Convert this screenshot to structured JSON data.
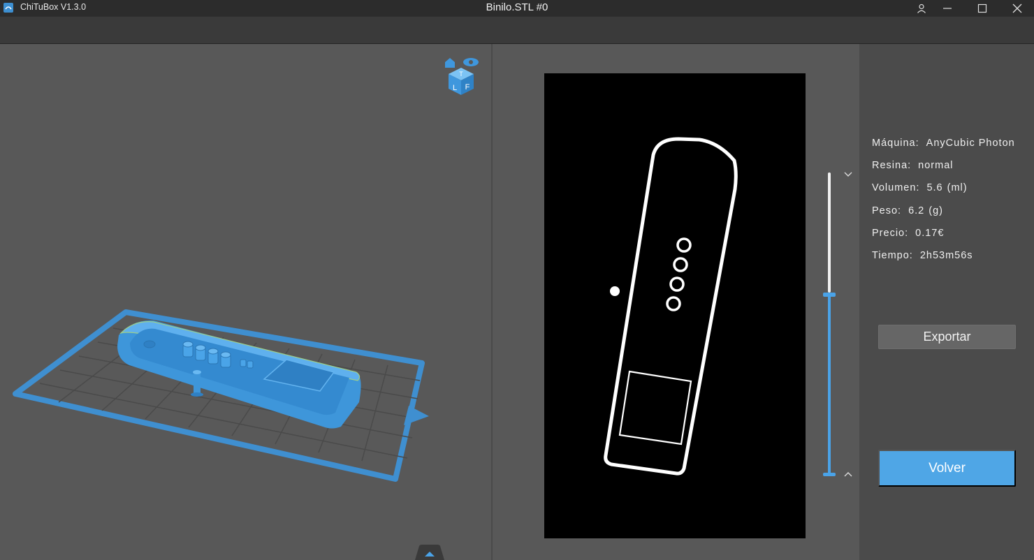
{
  "titlebar": {
    "app_name": "ChiTuBox V1.3.0",
    "document_title": "Binilo.STL #0",
    "icons": [
      "app-logo-icon",
      "user-icon",
      "minimize-icon",
      "maximize-icon",
      "close-icon"
    ]
  },
  "viewport": {
    "view_cube_icon": "view-cube-icon",
    "view_cube_faces": [
      "T",
      "L",
      "F"
    ],
    "collapse_icon": "chevron-up-icon"
  },
  "preview": {
    "layer_slider": {
      "position": 0.4,
      "up_icon": "chevron-down-icon",
      "down_icon": "chevron-up-icon"
    }
  },
  "info": {
    "machine_label": "Máquina:",
    "machine_value": "AnyCubic Photon",
    "resin_label": "Resina:",
    "resin_value": "normal",
    "volume_label": "Volumen:",
    "volume_value": "5.6",
    "volume_unit": "(ml)",
    "weight_label": "Peso:",
    "weight_value": "6.2",
    "weight_unit": "(g)",
    "price_label": "Precio:",
    "price_value": "0.17€",
    "time_label": "Tiempo:",
    "time_value": "2h53m56s"
  },
  "actions": {
    "export_label": "Exportar",
    "back_label": "Volver"
  },
  "colors": {
    "accent": "#4fa6e6",
    "model": "#3f97dd",
    "viewport_bg": "#585858",
    "panel_bg": "#4b4b4b",
    "slice_bg": "#000000"
  }
}
